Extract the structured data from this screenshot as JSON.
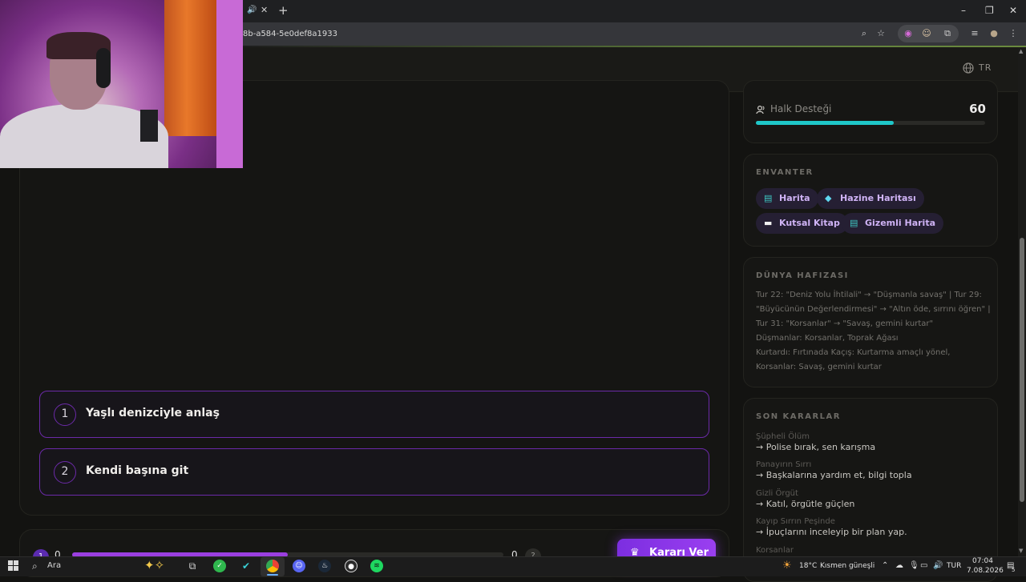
{
  "browser": {
    "url_fragment": "8b-a584-5e0def8a1933",
    "tab_audio_icon": "speaker-icon",
    "tab_close_glyph": "✕",
    "new_tab_glyph": "+",
    "minimize_glyph": "–",
    "restore_glyph": "❐",
    "close_glyph": "✕"
  },
  "header": {
    "language": "TR"
  },
  "choices": [
    {
      "number": "1",
      "label": "Yaşlı denizciyle anlaş"
    },
    {
      "number": "2",
      "label": "Kendi başına git"
    }
  ],
  "progress": {
    "step_current": "1",
    "step_left": "0",
    "step_right": "0",
    "fill_fraction": 0.5,
    "decide_label": "Kararı Ver"
  },
  "support": {
    "label": "Halk Desteği",
    "value": "60",
    "fraction": 0.6,
    "bar_color": "#1fc7c9"
  },
  "inventory": {
    "title": "ENVANTER",
    "items": [
      {
        "label": "Harita",
        "icon": "map-icon"
      },
      {
        "label": "Hazine Haritası",
        "icon": "gem-icon"
      },
      {
        "label": "Kutsal Kitap",
        "icon": "book-icon"
      },
      {
        "label": "Gizemli Harita",
        "icon": "map-icon"
      }
    ]
  },
  "world_memory": {
    "title": "DÜNYA HAFIZASI",
    "lines": [
      "Tur 22: \"Deniz Yolu İhtilali\" → \"Düşmanla savaş\" | Tur 29:",
      "\"Büyücünün Değerlendirmesi\" → \"Altın öde, sırrını öğren\" |",
      "Tur 31: \"Korsanlar\" → \"Savaş, gemini kurtar\"",
      "Düşmanlar: Korsanlar, Toprak Ağası",
      "Kurtardı: Fırtınada Kaçış: Kurtarma amaçlı yönel,",
      "Korsanlar: Savaş, gemini kurtar"
    ]
  },
  "recent_decisions": {
    "title": "SON KARARLAR",
    "items": [
      {
        "title": "Şüpheli Ölüm",
        "choice": "→ Polise bırak, sen karışma"
      },
      {
        "title": "Panayırın Sırrı",
        "choice": "→ Başkalarına yardım et, bilgi topla"
      },
      {
        "title": "Gizli Örgüt",
        "choice": "→ Katıl, örgütle güçlen"
      },
      {
        "title": "Kayıp Sırrın Peşinde",
        "choice": "→ İpuçlarını inceleyip bir plan yap."
      },
      {
        "title": "Korsanlar",
        "choice": ""
      }
    ]
  },
  "taskbar": {
    "search_label": "Ara",
    "weather": "18°C",
    "weather_text": "Kısmen güneşli",
    "lang": "TUR",
    "time": "07:04",
    "date": "7.08.2026",
    "notif_count": "5"
  }
}
